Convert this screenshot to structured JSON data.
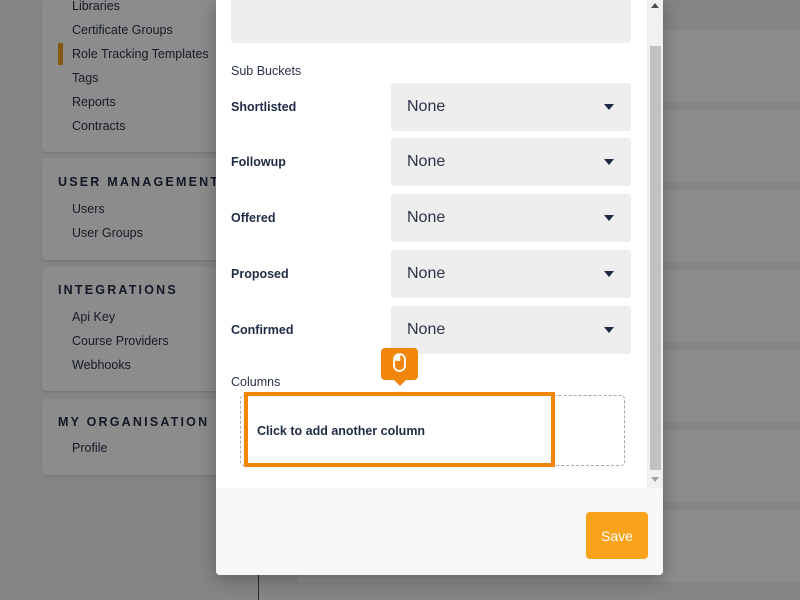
{
  "sidebar": {
    "settings_items": [
      {
        "label": "Libraries"
      },
      {
        "label": "Certificate Groups"
      },
      {
        "label": "Role Tracking Templates"
      },
      {
        "label": "Tags"
      },
      {
        "label": "Reports"
      },
      {
        "label": "Contracts"
      }
    ],
    "user_management": {
      "title": "USER MANAGEMENT",
      "items": [
        {
          "label": "Users"
        },
        {
          "label": "User Groups"
        }
      ]
    },
    "integrations": {
      "title": "INTEGRATIONS",
      "items": [
        {
          "label": "Api Key"
        },
        {
          "label": "Course Providers"
        },
        {
          "label": "Webhooks"
        }
      ]
    },
    "my_organisation": {
      "title": "MY ORGANISATION",
      "items": [
        {
          "label": "Profile"
        }
      ]
    }
  },
  "modal": {
    "sub_buckets_heading": "Sub Buckets",
    "sub_buckets": [
      {
        "label": "Shortlisted",
        "value": "None"
      },
      {
        "label": "Followup",
        "value": "None"
      },
      {
        "label": "Offered",
        "value": "None"
      },
      {
        "label": "Proposed",
        "value": "None"
      },
      {
        "label": "Confirmed",
        "value": "None"
      }
    ],
    "columns_heading": "Columns",
    "add_column_label": "Click to add another column",
    "save_label": "Save"
  },
  "colors": {
    "accent": "#f9a21b",
    "highlight": "#f2860c",
    "text_dark": "#1f2a44",
    "field_bg": "#eeeeee"
  },
  "icons": {
    "caret": "caret-down-icon",
    "pointer": "mouse-icon"
  }
}
